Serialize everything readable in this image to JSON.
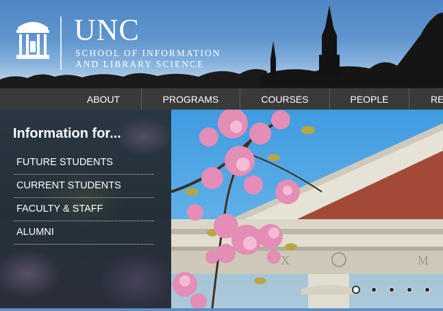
{
  "header": {
    "logo_text": "UNC",
    "school_line1": "SCHOOL OF INFORMATION",
    "school_line2": "AND LIBRARY SCIENCE"
  },
  "nav": {
    "items": [
      {
        "label": "ABOUT"
      },
      {
        "label": "PROGRAMS"
      },
      {
        "label": "COURSES"
      },
      {
        "label": "PEOPLE"
      },
      {
        "label": "RE"
      }
    ]
  },
  "info": {
    "title": "Information for...",
    "items": [
      {
        "label": "FUTURE STUDENTS"
      },
      {
        "label": "CURRENT STUDENTS"
      },
      {
        "label": "FACULTY & STAFF"
      },
      {
        "label": "ALUMNI"
      }
    ]
  },
  "slider": {
    "slide_count": 5,
    "active_index": 0
  },
  "colors": {
    "header_blue": "#5f95cf",
    "nav_bg": "#3a3a3a",
    "sky": "#5aa7e2",
    "blossom": "#e58fb6"
  }
}
